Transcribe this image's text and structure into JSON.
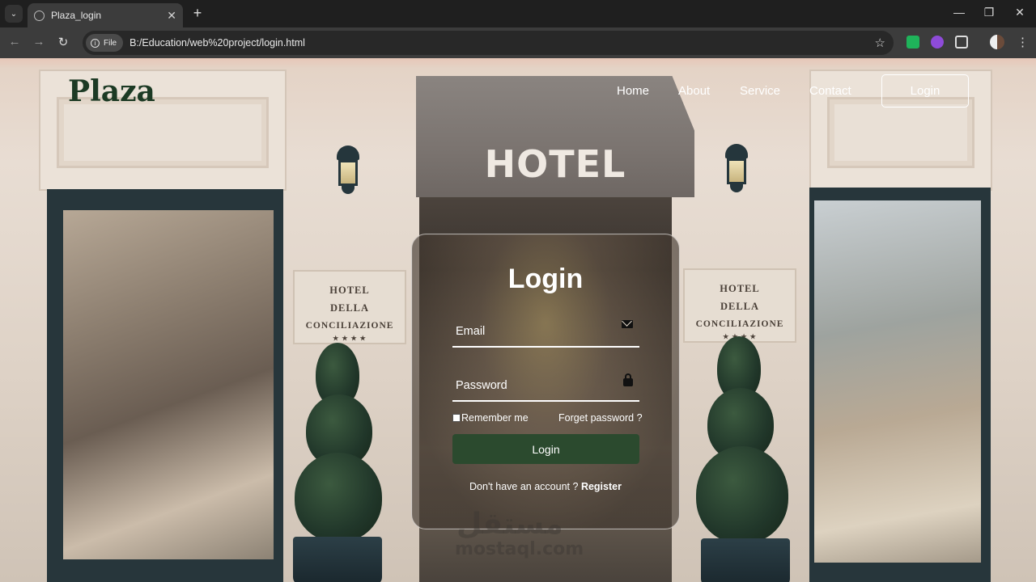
{
  "browser": {
    "tab_title": "Plaza_login",
    "tab_close": "✕",
    "new_tab": "+",
    "address_chip": "File",
    "url": "B:/Education/web%20project/login.html",
    "back": "←",
    "forward": "→",
    "reload": "↻",
    "star": "☆",
    "minimize": "—",
    "maximize": "❐",
    "close": "✕",
    "menu": "⋮",
    "tab_search": "⌄"
  },
  "site": {
    "logo": "Plaza",
    "nav": [
      "Home",
      "About",
      "Service",
      "Contact"
    ],
    "nav_login": "Login"
  },
  "background": {
    "awning_text": "HOTEL",
    "plaque_left": [
      "HOTEL",
      "DELLA",
      "CONCILIAZIONE",
      "★ ★ ★ ★"
    ],
    "plaque_right": [
      "HOTEL",
      "DELLA",
      "CONCILIAZIONE",
      "★ ★ ★ ★"
    ]
  },
  "login_card": {
    "title": "Login",
    "email_label": "Email",
    "password_label": "Password",
    "remember_label": "Remember me",
    "forgot_label": "Forget password ?",
    "submit_label": "Login",
    "register_prompt": "Don't have an account ?",
    "register_link": "Register"
  },
  "watermark": {
    "arabic": "مستقل",
    "latin": "mostaql.com"
  },
  "colors": {
    "logo": "#1c3a24",
    "button": "#2b4a2e"
  }
}
